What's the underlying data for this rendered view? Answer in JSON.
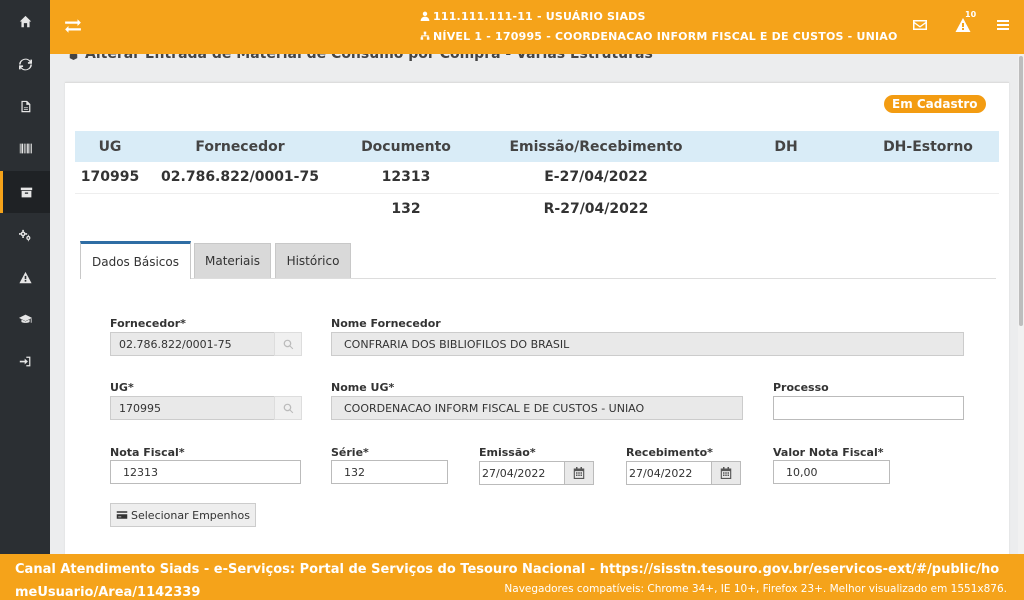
{
  "colors": {
    "accent": "#f5a31a",
    "sidebar": "#2b2f33",
    "badge": "#f39c12",
    "table_header": "#d9ecf7",
    "tab_active_border": "#2e6da4"
  },
  "sidebar": {
    "items": [
      {
        "icon": "home-icon"
      },
      {
        "icon": "refresh-icon"
      },
      {
        "icon": "document-icon"
      },
      {
        "icon": "barcode-icon"
      },
      {
        "icon": "archive-icon",
        "active": true
      },
      {
        "icon": "cogs-icon"
      },
      {
        "icon": "warning-icon"
      },
      {
        "icon": "graduation-cap-icon"
      },
      {
        "icon": "sign-in-icon"
      }
    ]
  },
  "header": {
    "user": "111.111.111-11 - USUÁRIO SIADS",
    "level": "NÍVEL 1 - 170995 - COORDENACAO INFORM FISCAL E DE CUSTOS - UNIAO",
    "alerts_count": "10",
    "icons": [
      "menu-toggle-icon",
      "envelope-icon",
      "warning-icon",
      "bars-icon"
    ]
  },
  "page": {
    "title": "Alterar Entrada de Material de Consumo por Compra - Várias Estruturas",
    "status": "Em Cadastro"
  },
  "summary": {
    "headers": [
      "UG",
      "Fornecedor",
      "Documento",
      "Emissão/Recebimento",
      "DH",
      "DH-Estorno"
    ],
    "rows": [
      [
        "170995",
        "02.786.822/0001-75",
        "12313",
        "E-27/04/2022",
        "",
        ""
      ],
      [
        "",
        "",
        "132",
        "R-27/04/2022",
        "",
        ""
      ]
    ]
  },
  "tabs": [
    {
      "label": "Dados Básicos",
      "active": true
    },
    {
      "label": "Materiais",
      "active": false
    },
    {
      "label": "Histórico",
      "active": false
    }
  ],
  "form": {
    "fornecedor": {
      "label": "Fornecedor*",
      "value": "02.786.822/0001-75"
    },
    "nome_fornecedor": {
      "label": "Nome Fornecedor",
      "value": "CONFRARIA DOS BIBLIOFILOS DO BRASIL"
    },
    "ug": {
      "label": "UG*",
      "value": "170995"
    },
    "nome_ug": {
      "label": "Nome UG*",
      "value": "COORDENACAO INFORM FISCAL E DE CUSTOS - UNIAO"
    },
    "processo": {
      "label": "Processo",
      "value": ""
    },
    "nota_fiscal": {
      "label": "Nota Fiscal*",
      "value": "12313"
    },
    "serie": {
      "label": "Série*",
      "value": "132"
    },
    "emissao": {
      "label": "Emissão*",
      "value": "27/04/2022"
    },
    "recebimento": {
      "label": "Recebimento*",
      "value": "27/04/2022"
    },
    "valor_nota": {
      "label": "Valor Nota Fiscal*",
      "value": "10,00"
    },
    "selecionar_empenhos": "Selecionar Empenhos"
  },
  "footer": {
    "main": "Canal Atendimento Siads - e-Serviços: Portal de Serviços do Tesouro Nacional - https://sisstn.tesouro.gov.br/eservicos-ext/#/public/homeUsuario/Area/1142339",
    "note": "Navegadores compatíveis: Chrome 34+, IE 10+, Firefox 23+. Melhor visualizado em 1551x876."
  }
}
